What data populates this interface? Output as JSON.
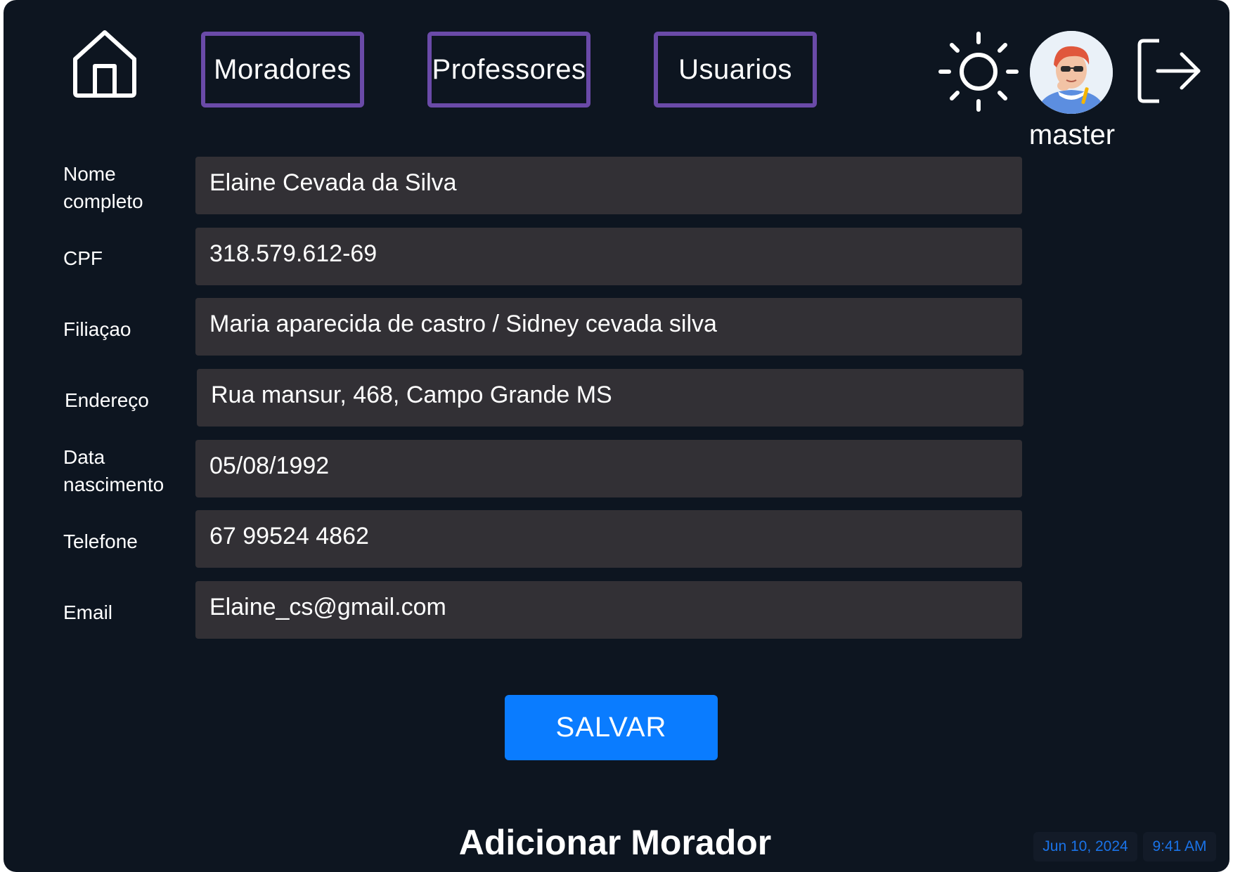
{
  "nav": {
    "home_icon": "home-icon",
    "tabs": [
      {
        "label": "Moradores"
      },
      {
        "label": "Professores"
      },
      {
        "label": "Usuarios"
      }
    ],
    "theme_icon": "sun-icon",
    "user": {
      "name": "master",
      "avatar_icon": "user-avatar"
    },
    "logout_icon": "logout-icon"
  },
  "form": {
    "fields": [
      {
        "label": "Nome\ncompleto",
        "value": "Elaine Cevada da Silva"
      },
      {
        "label": "CPF",
        "value": "318.579.612-69"
      },
      {
        "label": "Filiaçao",
        "value": "Maria aparecida de castro / Sidney cevada silva"
      },
      {
        "label": "Endereço",
        "value": "Rua mansur, 468, Campo Grande MS"
      },
      {
        "label": "Data\nnascimento",
        "value": "05/08/1992"
      },
      {
        "label": "Telefone",
        "value": "67 99524 4862"
      },
      {
        "label": "Email",
        "value": "Elaine_cs@gmail.com"
      }
    ],
    "save_label": "SALVAR"
  },
  "page": {
    "title": "Adicionar Morador"
  },
  "status": {
    "date": "Jun 10, 2024",
    "time": "9:41 AM"
  },
  "colors": {
    "background": "#0d1520",
    "tab_border": "#6a4aa8",
    "input_bg": "#323035",
    "accent": "#0a7cff",
    "status_text": "#1a73e8"
  }
}
